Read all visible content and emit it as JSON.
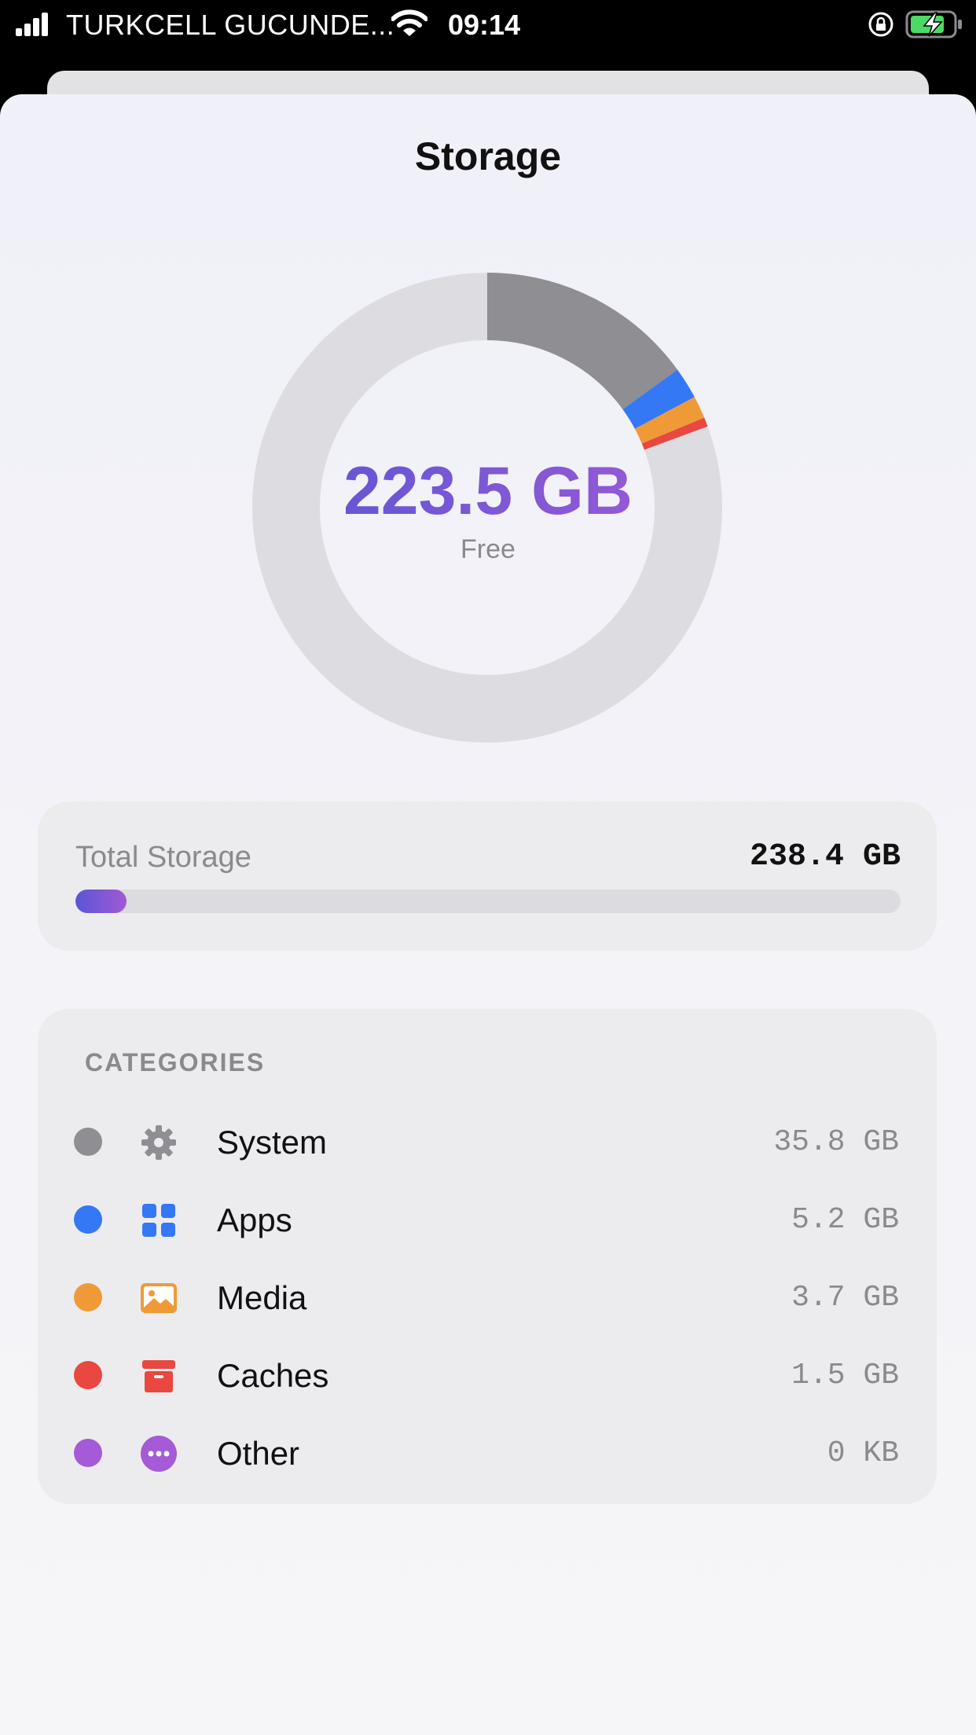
{
  "status_bar": {
    "carrier": "TURKCELL GUCUNDE...",
    "time": "09:14",
    "icons": [
      "signal-icon",
      "wifi-icon",
      "rotation-lock-icon",
      "battery-charging-icon"
    ]
  },
  "page": {
    "title": "Storage"
  },
  "donut": {
    "center_value": "223.5 GB",
    "center_label": "Free",
    "track_color": "#dddde1",
    "segments": [
      {
        "name": "System",
        "gb": 35.8,
        "color": "#8e8e93"
      },
      {
        "name": "Apps",
        "gb": 5.2,
        "color": "#3478f6"
      },
      {
        "name": "Media",
        "gb": 3.7,
        "color": "#f09a37"
      },
      {
        "name": "Caches",
        "gb": 1.5,
        "color": "#e9473f"
      }
    ],
    "total_gb": 238.4
  },
  "total_storage": {
    "label": "Total Storage",
    "value": "238.4 GB",
    "used_fraction": 0.062,
    "fill_gradient": [
      "#5a55d6",
      "#a05ad6"
    ]
  },
  "categories": {
    "header": "CATEGORIES",
    "items": [
      {
        "name": "System",
        "size": "35.8 GB",
        "color": "#8e8e93",
        "icon": "gear-icon"
      },
      {
        "name": "Apps",
        "size": "5.2 GB",
        "color": "#3478f6",
        "icon": "apps-grid-icon"
      },
      {
        "name": "Media",
        "size": "3.7 GB",
        "color": "#f09a37",
        "icon": "photo-icon"
      },
      {
        "name": "Caches",
        "size": "1.5 GB",
        "color": "#e9473f",
        "icon": "archive-box-icon"
      },
      {
        "name": "Other",
        "size": "0 KB",
        "color": "#a55ad8",
        "icon": "ellipsis-circle-icon"
      }
    ]
  }
}
